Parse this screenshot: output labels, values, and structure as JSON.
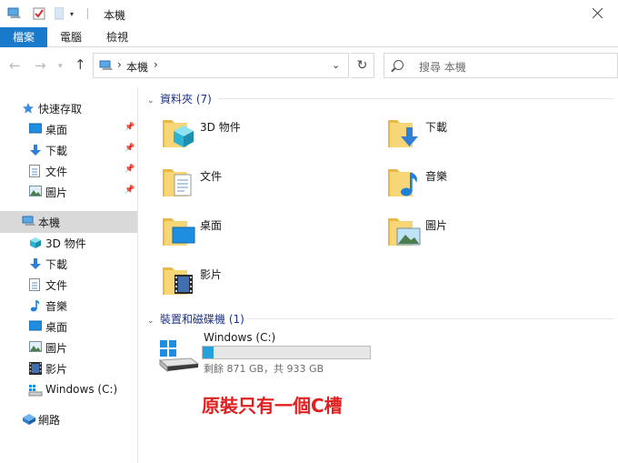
{
  "window": {
    "title": "本機"
  },
  "ribbon": {
    "tabs": [
      "檔案",
      "電腦",
      "檢視"
    ]
  },
  "address": {
    "path": "本機",
    "search_placeholder": "搜尋 本機"
  },
  "sidebar": {
    "quick_access": "快速存取",
    "quick_items": [
      "桌面",
      "下載",
      "文件",
      "圖片"
    ],
    "this_pc": "本機",
    "pc_items": [
      "3D 物件",
      "下載",
      "文件",
      "音樂",
      "桌面",
      "圖片",
      "影片",
      "Windows (C:)"
    ],
    "network": "網路"
  },
  "content": {
    "folders_header": "資料夾 (7)",
    "folders": [
      "3D 物件",
      "下載",
      "文件",
      "音樂",
      "桌面",
      "圖片",
      "影片"
    ],
    "devices_header": "裝置和磁碟機 (1)",
    "drive": {
      "name": "Windows (C:)",
      "info": "剩餘 871 GB，共 933 GB",
      "used_fraction": 0.066
    }
  },
  "annotation": "原裝只有一個C槽",
  "colors": {
    "accent": "#1979ca",
    "folder": "#f5d26b",
    "annotation": "#e02020",
    "drive_fill": "#26a0da"
  }
}
